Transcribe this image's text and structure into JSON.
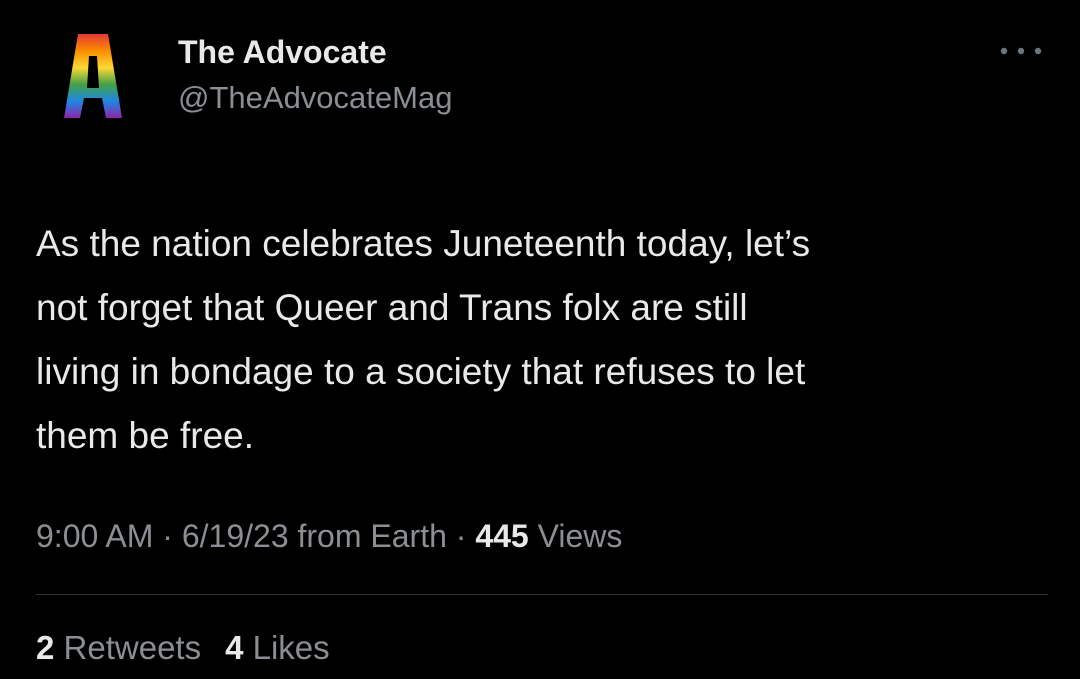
{
  "author": {
    "display_name": "The Advocate",
    "handle": "@TheAdvocateMag",
    "avatar_icon": "rainbow-a-logo-icon",
    "avatar_logo_text": "A",
    "avatar_colors": [
      "#e53935",
      "#fb8c00",
      "#fdd835",
      "#43a047",
      "#1e88e5",
      "#8e24aa"
    ]
  },
  "more_icon": "more-options-icon",
  "tweet": {
    "lines": [
      "As the nation celebrates Juneteenth today, let’s",
      "not forget that Queer and Trans folx are still",
      "living in bondage to a society that refuses to let",
      "them be free."
    ]
  },
  "meta": {
    "time": "9:00 AM",
    "separator": "·",
    "date": "6/19/23",
    "source": "from Earth",
    "views_count": "445",
    "views_label": "Views"
  },
  "stats": {
    "retweets_count": "2",
    "retweets_label": "Retweets",
    "likes_count": "4",
    "likes_label": "Likes"
  },
  "colors": {
    "background": "#000000",
    "primary_text": "#e7e9ea",
    "secondary_text": "#8b8f94",
    "divider": "#2f3336"
  }
}
